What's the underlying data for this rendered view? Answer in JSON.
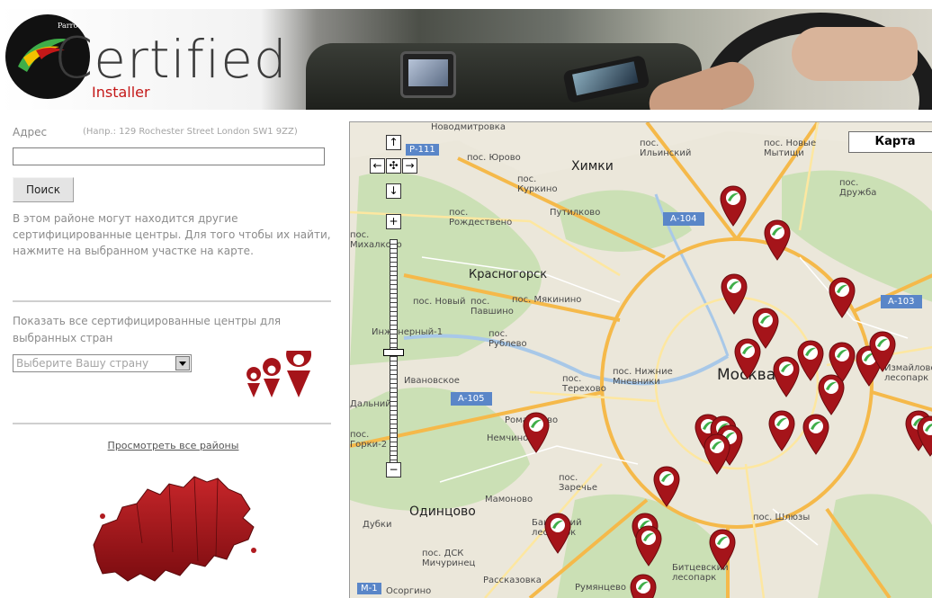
{
  "header": {
    "brand_small": "Parrot",
    "logo_text": "ertified",
    "logo_sub": "Installer",
    "colors": {
      "logo_red": "#c41818",
      "logo_green": "#3fae49",
      "pin_red": "#a5141a"
    }
  },
  "sidebar": {
    "address_label": "Адрес",
    "address_hint": "(Напр.: 129 Rochester Street London SW1 9ZZ)",
    "address_value": "",
    "search_button": "Поиск",
    "info_text": "В этом районе могут находится другие сертифицированные центры. Для того чтобы их найти, нажмите на выбранном участке на карте.",
    "show_all_text": "Показать все сертифицированные центры для выбранных стран",
    "country_select_value": "Выберите Вашу страну",
    "view_all_link": "Просмотреть все районы"
  },
  "map": {
    "type_button": "Карта",
    "nav_up": "↑",
    "nav_left": "←",
    "nav_center": "✣",
    "nav_right": "→",
    "nav_down": "↓",
    "zoom_in": "+",
    "zoom_out": "−",
    "labels": {
      "khimki": "Химки",
      "yurovo": "пос. Юрово",
      "kurkino": "пос. Куркино",
      "rozhdestveno": "пос. Рождествено",
      "putilkovo": "Путилково",
      "ilyinsky": "пос. Ильинский",
      "novye_mytishchi": "пос. Новые Мытищи",
      "druzhba": "пос. Дружба",
      "krasnogorsk": "Красногорск",
      "pavshino": "пос. Павшино",
      "myakinino": "пос. Мякинино",
      "novy": "пос. Новый",
      "inzhenerny": "Инженерный-1",
      "rublevo": "пос. Рублево",
      "moskva": "Москва",
      "nizhnie_mnevniki": "пос. Нижние Мневники",
      "terekhovo": "пос. Терехово",
      "romashkovo": "Ромашково",
      "nemchinovka": "Немчиновка",
      "zarechye": "пос. Заречье",
      "mamonovo": "Мамоново",
      "odintsovo": "Одинцово",
      "dubki": "Дубки",
      "bakovsky": "Баковский лесопарк",
      "dsk": "пос. ДСК Мичуринец",
      "rasskazovka": "Рассказовка",
      "rumyantsevo": "Румянцево",
      "bitsevsky": "Битцевский лесопарк",
      "shluzy": "пос. Шлюзы",
      "osorgino": "Осоргино",
      "izmailovsky": "Измайловский лесопарк",
      "ivanovskoe": "Ивановское",
      "dalny": "Дальний",
      "gorki": "пос. Горки-2",
      "mikhalkovo": "пос. Михалково",
      "novodmitrovka": "Новодмитровка"
    },
    "roads": {
      "r111": "Р-111",
      "a104": "А-104",
      "a103": "А-103",
      "a105": "А-105",
      "m1": "М-1"
    }
  }
}
